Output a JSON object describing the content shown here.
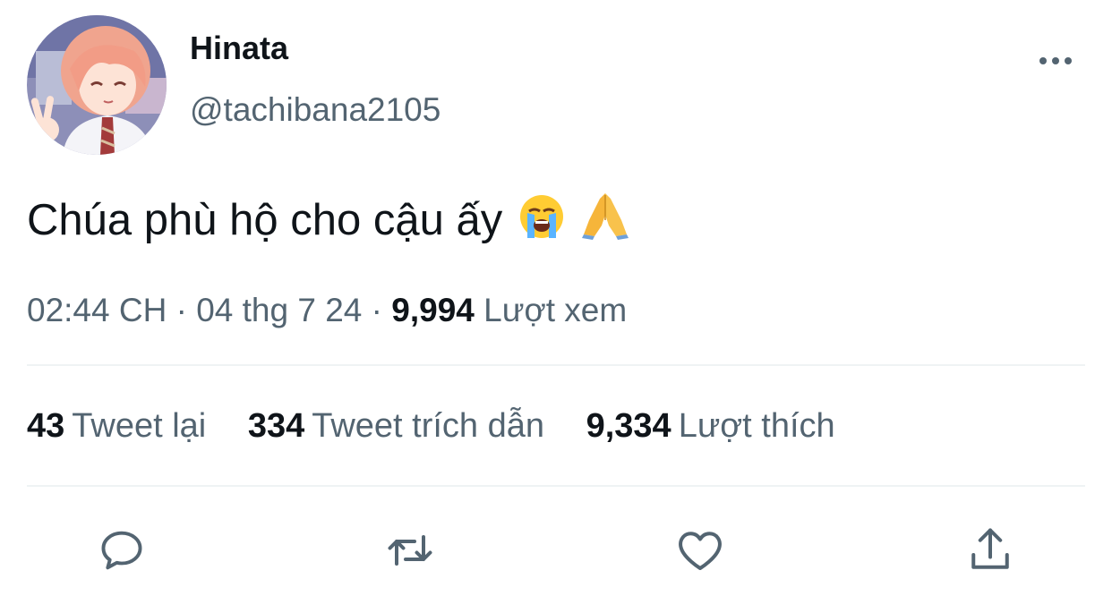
{
  "author": {
    "name": "Hinata",
    "handle": "@tachibana2105"
  },
  "tweet": {
    "text": "Chúa phù hộ cho cậu ấy",
    "emojis": [
      "loudly-crying-face",
      "folded-hands"
    ]
  },
  "meta": {
    "time": "02:44 CH",
    "separator": "·",
    "date": "04 thg 7 24",
    "views_count": "9,994",
    "views_label": "Lượt xem"
  },
  "stats": [
    {
      "count": "43",
      "label": "Tweet lại"
    },
    {
      "count": "334",
      "label": "Tweet trích dẫn"
    },
    {
      "count": "9,334",
      "label": "Lượt thích"
    }
  ],
  "actions": [
    "reply-icon",
    "retweet-icon",
    "like-icon",
    "share-icon"
  ],
  "colors": {
    "text": "#0f1419",
    "secondary": "#536471",
    "divider": "#eff3f4",
    "icon": "#536471"
  }
}
